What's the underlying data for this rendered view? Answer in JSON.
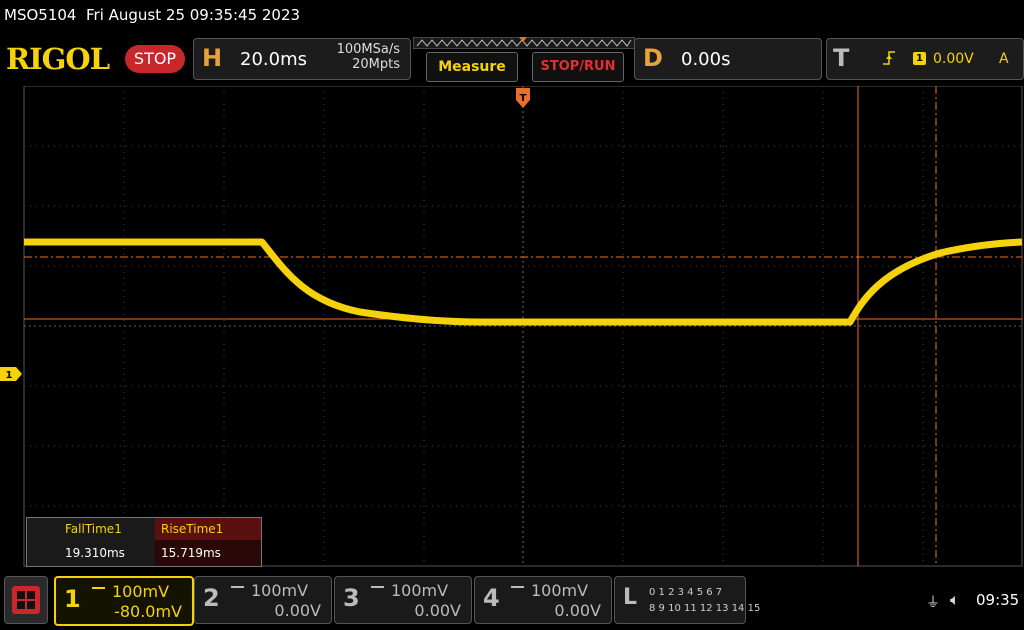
{
  "header": {
    "model": "MSO5104",
    "datetime": "Fri August 25 09:35:45 2023",
    "logo": "RIGOL",
    "run_state": "STOP"
  },
  "horizontal": {
    "letter": "H",
    "timebase": "20.0ms",
    "sample_rate": "100MSa/s",
    "memory_depth": "20Mpts"
  },
  "buttons": {
    "measure": "Measure",
    "stop_run": "STOP/RUN"
  },
  "delay": {
    "letter": "D",
    "value": "0.00s"
  },
  "trigger": {
    "letter": "T",
    "source": "1",
    "level": "0.00V",
    "mode": "A"
  },
  "channel_marker": "1",
  "measurements": [
    {
      "label": "FallTime1",
      "value": "19.310ms"
    },
    {
      "label": "RiseTime1",
      "value": "15.719ms"
    }
  ],
  "channels": [
    {
      "num": "1",
      "scale": "100mV",
      "offset": "-80.0mV",
      "color": "#f5d20a"
    },
    {
      "num": "2",
      "scale": "100mV",
      "offset": "0.00V",
      "color": "#bbbbbb"
    },
    {
      "num": "3",
      "scale": "100mV",
      "offset": "0.00V",
      "color": "#bbbbbb"
    },
    {
      "num": "4",
      "scale": "100mV",
      "offset": "0.00V",
      "color": "#bbbbbb"
    }
  ],
  "logic": {
    "letter": "L",
    "row1": "0 1 2 3  4 5 6 7",
    "row2": "8 9 10 11 12 13 14 15"
  },
  "status": {
    "time": "09:35"
  },
  "colors": {
    "trace": "#f5d20a",
    "cursor": "#e8702a",
    "grid": "#555555"
  }
}
